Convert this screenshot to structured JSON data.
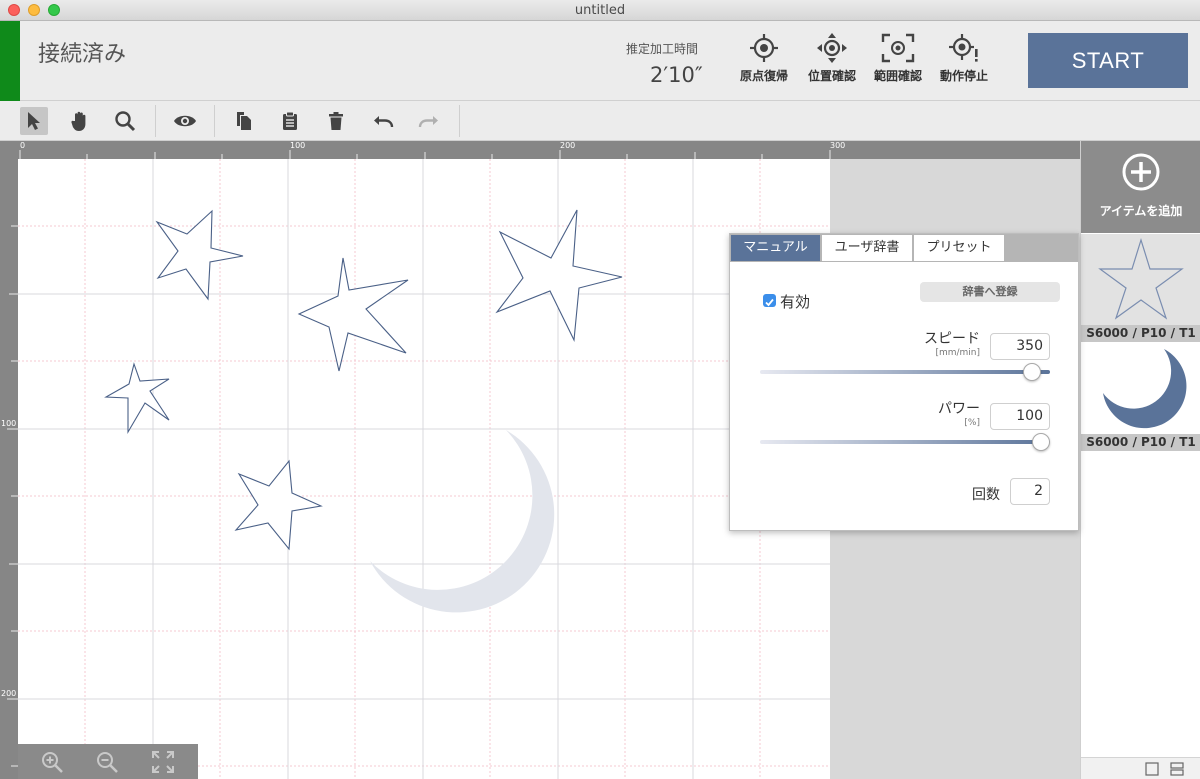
{
  "window": {
    "title": "untitled"
  },
  "header": {
    "connection_status": "接続済み",
    "estimate_label": "推定加工時間",
    "estimate_value": "2′10″",
    "buttons": [
      {
        "label": "原点復帰",
        "icon": "origin-return-icon"
      },
      {
        "label": "位置確認",
        "icon": "position-check-icon"
      },
      {
        "label": "範囲確認",
        "icon": "range-check-icon"
      },
      {
        "label": "動作停止",
        "icon": "stop-motion-icon"
      }
    ],
    "start_label": "START",
    "status_color": "#0f8a1a",
    "accent_color": "#5a7399"
  },
  "toolbar": {
    "tools": [
      "select-arrow-icon",
      "hand-pan-icon",
      "zoom-icon",
      "preview-eye-icon",
      "copy-icon",
      "paste-icon",
      "trash-icon",
      "undo-icon",
      "redo-icon"
    ]
  },
  "rulers": {
    "top_labels": [
      "0",
      "100",
      "200",
      "300"
    ],
    "left_labels": [
      "100",
      "200"
    ]
  },
  "right_panel": {
    "add_label": "アイテムを追加",
    "items": [
      {
        "caption": "S6000 / P10 / T1",
        "shape": "star"
      },
      {
        "caption": "S6000 / P10 / T1",
        "shape": "moon"
      }
    ]
  },
  "settings": {
    "tabs": [
      "マニュアル",
      "ユーザ辞書",
      "プリセット"
    ],
    "active_tab": "マニュアル",
    "register_label": "辞書へ登録",
    "enabled_label": "有効",
    "enabled": true,
    "speed": {
      "label": "スピード",
      "unit": "[mm/min]",
      "value": "350"
    },
    "power": {
      "label": "パワー",
      "unit": "[%]",
      "value": "100"
    },
    "count": {
      "label": "回数",
      "value": "2"
    }
  }
}
